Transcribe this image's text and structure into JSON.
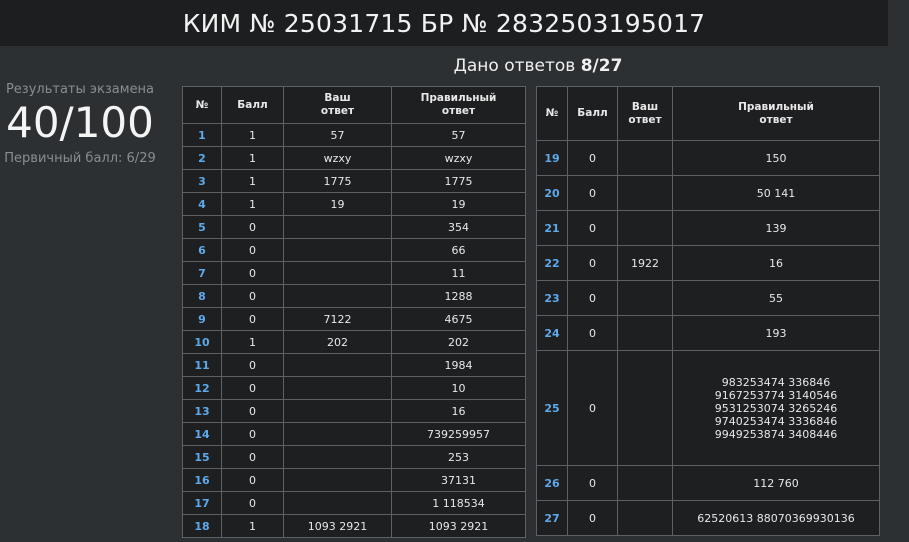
{
  "header": {
    "title": "КИМ № 25031715 БР № 2832503195017"
  },
  "summary": {
    "results_caption": "Результаты экзамена",
    "score": "40/100",
    "primary_score": "Первичный балл: 6/29",
    "answers_given_label": "Дано ответов",
    "answers_given_value": "8/27"
  },
  "table_headers": {
    "num": "№",
    "points": "Балл",
    "your_answer_l1": "Ваш",
    "your_answer_l2": "ответ",
    "correct_l1": "Правильный",
    "correct_l2": "ответ"
  },
  "left_rows": [
    {
      "n": "1",
      "points": "1",
      "answer": "57",
      "correct": "57"
    },
    {
      "n": "2",
      "points": "1",
      "answer": "wzxy",
      "correct": "wzxy"
    },
    {
      "n": "3",
      "points": "1",
      "answer": "1775",
      "correct": "1775"
    },
    {
      "n": "4",
      "points": "1",
      "answer": "19",
      "correct": "19"
    },
    {
      "n": "5",
      "points": "0",
      "answer": "",
      "correct": "354"
    },
    {
      "n": "6",
      "points": "0",
      "answer": "",
      "correct": "66"
    },
    {
      "n": "7",
      "points": "0",
      "answer": "",
      "correct": "11"
    },
    {
      "n": "8",
      "points": "0",
      "answer": "",
      "correct": "1288"
    },
    {
      "n": "9",
      "points": "0",
      "answer": "7122",
      "correct": "4675"
    },
    {
      "n": "10",
      "points": "1",
      "answer": "202",
      "correct": "202"
    },
    {
      "n": "11",
      "points": "0",
      "answer": "",
      "correct": "1984"
    },
    {
      "n": "12",
      "points": "0",
      "answer": "",
      "correct": "10"
    },
    {
      "n": "13",
      "points": "0",
      "answer": "",
      "correct": "16"
    },
    {
      "n": "14",
      "points": "0",
      "answer": "",
      "correct": "739259957"
    },
    {
      "n": "15",
      "points": "0",
      "answer": "",
      "correct": "253"
    },
    {
      "n": "16",
      "points": "0",
      "answer": "",
      "correct": "37131"
    },
    {
      "n": "17",
      "points": "0",
      "answer": "",
      "correct": "1 118534"
    },
    {
      "n": "18",
      "points": "1",
      "answer": "1093 2921",
      "correct": "1093 2921"
    }
  ],
  "right_rows": [
    {
      "n": "19",
      "points": "0",
      "answer": "",
      "correct": "150"
    },
    {
      "n": "20",
      "points": "0",
      "answer": "",
      "correct": "50 141"
    },
    {
      "n": "21",
      "points": "0",
      "answer": "",
      "correct": "139"
    },
    {
      "n": "22",
      "points": "0",
      "answer": "1922",
      "correct": "16"
    },
    {
      "n": "23",
      "points": "0",
      "answer": "",
      "correct": "55"
    },
    {
      "n": "24",
      "points": "0",
      "answer": "",
      "correct": "193"
    },
    {
      "n": "25",
      "points": "0",
      "answer": "",
      "correct_lines": [
        "983253474 336846",
        "9167253774 3140546",
        "9531253074 3265246",
        "9740253474 3336846",
        "9949253874 3408446"
      ]
    },
    {
      "n": "26",
      "points": "0",
      "answer": "",
      "correct": "112 760"
    },
    {
      "n": "27",
      "points": "0",
      "answer": "",
      "correct": "62520613 88070369930136"
    }
  ]
}
